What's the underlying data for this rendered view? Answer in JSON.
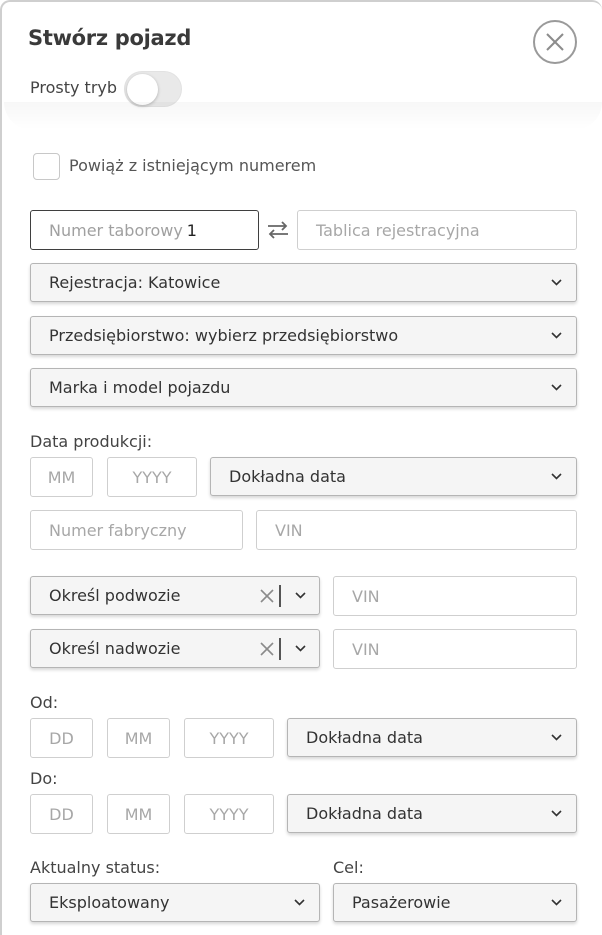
{
  "modal": {
    "title": "Stwórz pojazd",
    "simple_mode_label": "Prosty tryb",
    "simple_mode_on": false,
    "link_existing_label": "Powiąż z istniejącym numerem",
    "link_existing_checked": false
  },
  "identity": {
    "fleet_number_placeholder": "Numer taborowy",
    "fleet_number_value": "1",
    "plate_placeholder": "Tablica rejestracyjna"
  },
  "selects": {
    "registration": "Rejestracja: Katowice",
    "company": "Przedsiębiorstwo: wybierz przedsiębiorstwo",
    "make_model": "Marka i model pojazdu"
  },
  "production": {
    "label": "Data produkcji:",
    "month_placeholder": "MM",
    "year_placeholder": "YYYY",
    "precision": "Dokładna data",
    "factory_number_placeholder": "Numer fabryczny",
    "vin_placeholder": "VIN"
  },
  "chassis": {
    "value": "Określ podwozie",
    "vin_placeholder": "VIN"
  },
  "body": {
    "value": "Określ nadwozie",
    "vin_placeholder": "VIN"
  },
  "from": {
    "label": "Od:",
    "day_placeholder": "DD",
    "month_placeholder": "MM",
    "year_placeholder": "YYYY",
    "precision": "Dokładna data"
  },
  "to": {
    "label": "Do:",
    "day_placeholder": "DD",
    "month_placeholder": "MM",
    "year_placeholder": "YYYY",
    "precision": "Dokładna data"
  },
  "status": {
    "label": "Aktualny status:",
    "value": "Eksploatowany"
  },
  "purpose": {
    "label": "Cel:",
    "value": "Pasażerowie"
  },
  "icons": {
    "close": "close-icon",
    "swap": "swap-icon",
    "chevron": "chevron-down-icon",
    "clear": "clear-icon"
  },
  "colors": {
    "field_border": "#cfcfcf",
    "select_bg": "#f5f5f5",
    "text_dark": "#333333",
    "placeholder": "#a7a7a7"
  }
}
